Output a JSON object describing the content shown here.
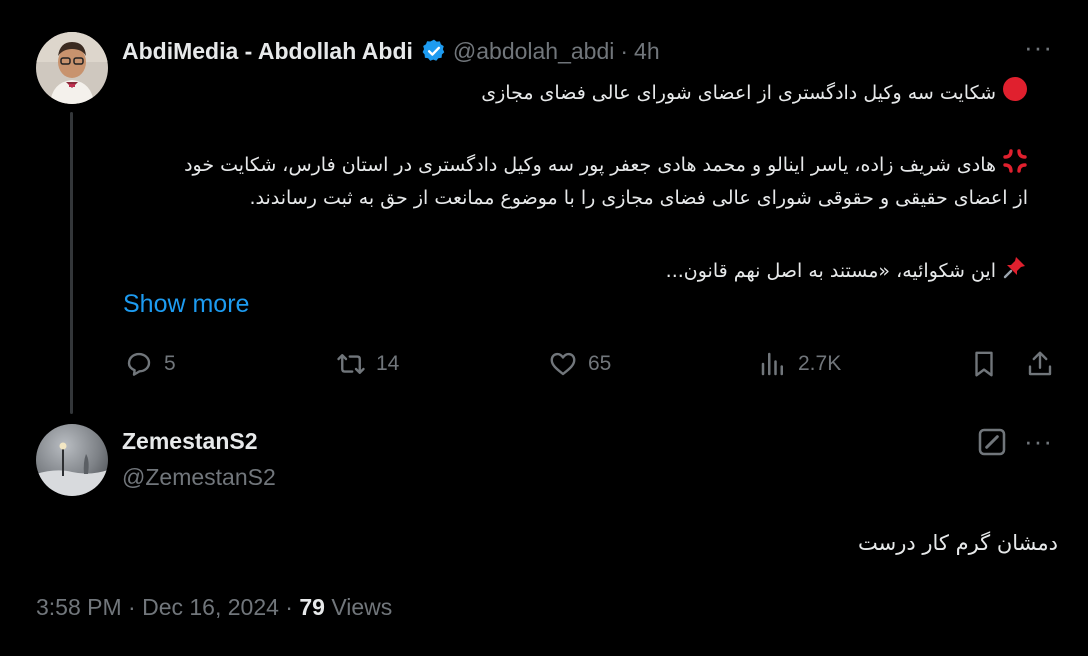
{
  "tweet": {
    "display_name": "AbdiMedia - Abdollah Abdi",
    "handle": "@abdolah_abdi",
    "time": "4h",
    "separator": "·",
    "line1": "شکایت سه وکیل دادگستری از اعضای شورای عالی فضای مجازی",
    "para2_line1": "هادی شریف زاده، یاسر اینالو و محمد هادی جعفر پور سه وکیل دادگستری در استان فارس، شکایت خود",
    "para2_line2": "از اعضای حقیقی و حقوقی شورای عالی فضای مجازی را با موضوع ممانعت از حق به ثبت رساندند.",
    "para3": "این شکوائیه، «مستند به اصل نهم قانون...",
    "show_more": "Show more",
    "replies": "5",
    "retweets": "14",
    "likes": "65",
    "views": "2.7K"
  },
  "reply": {
    "display_name": "ZemestanS2",
    "handle": "@ZemestanS2",
    "text": "دمشان گرم کار درست",
    "timestamp": "3:58 PM · Dec 16, 2024 · ",
    "view_count": "79",
    "views_label": " Views"
  },
  "icons": {
    "menu": "more-dots-icon",
    "verified": "verified-badge-icon",
    "reply": "reply-icon",
    "retweet": "retweet-icon",
    "like": "heart-icon",
    "views": "views-chart-icon",
    "bookmark": "bookmark-icon",
    "share": "share-icon",
    "edit": "edit-icon",
    "red_circle": "red-circle-emoji",
    "anger": "anger-symbol-emoji",
    "pin": "pushpin-emoji"
  },
  "colors": {
    "background": "#000000",
    "text": "#e7e9ea",
    "muted": "#71767b",
    "accent": "#1d9bf0",
    "emoji_red": "#e0202e"
  }
}
